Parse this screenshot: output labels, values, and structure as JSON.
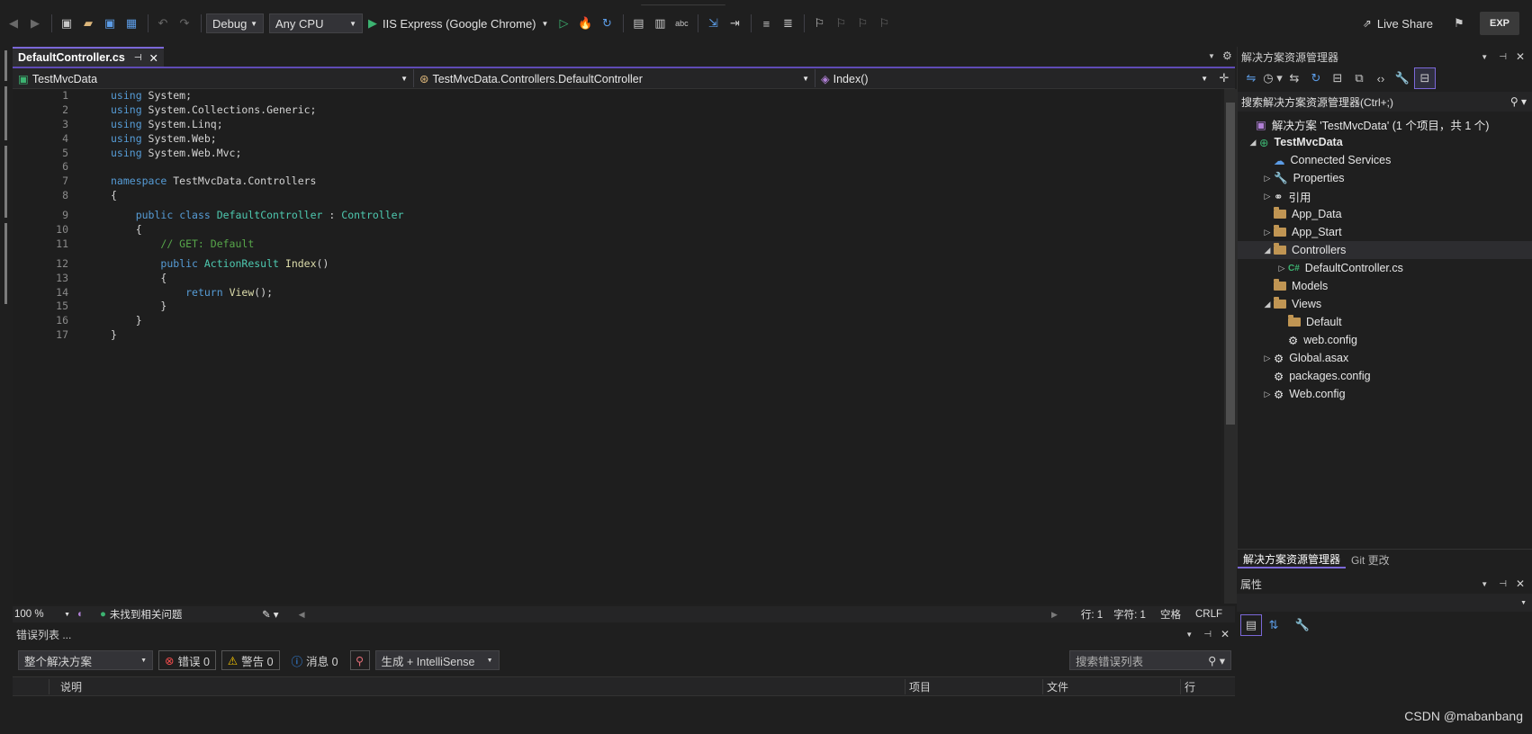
{
  "toolbar": {
    "config": "Debug",
    "platform": "Any CPU",
    "run_target": "IIS Express (Google Chrome)",
    "live_share": "Live Share",
    "exp": "EXP"
  },
  "editor": {
    "tab_title": "DefaultController.cs",
    "nav_project": "TestMvcData",
    "nav_class": "TestMvcData.Controllers.DefaultController",
    "nav_member": "Index()",
    "line_numbers": [
      "1",
      "2",
      "3",
      "4",
      "5",
      "6",
      "7",
      "8",
      "9",
      "10",
      "11",
      "12",
      "13",
      "14",
      "15",
      "16",
      "17"
    ],
    "code": {
      "l1": [
        "using",
        " System;"
      ],
      "l2": [
        "using",
        " System.Collections.Generic;"
      ],
      "l3": [
        "using",
        " System.Linq;"
      ],
      "l4": [
        "using",
        " System.Web;"
      ],
      "l5": [
        "using",
        " System.Web.Mvc;"
      ],
      "l7": [
        "namespace",
        " TestMvcData.Controllers"
      ],
      "l8": "{",
      "l9": [
        "public",
        "class",
        "DefaultController",
        ":",
        "Controller"
      ],
      "l10": "{",
      "l11": "// GET: Default",
      "l12": [
        "public",
        "ActionResult",
        "Index",
        "()"
      ],
      "l13": "{",
      "l14": [
        "return",
        "View",
        "();"
      ],
      "l15": "}",
      "l16": "}",
      "l17": "}"
    },
    "zoom": "100 %",
    "no_issues": "未找到相关问题",
    "line_pos": "行: 1",
    "char_pos": "字符: 1",
    "whitespace": "空格",
    "line_ending": "CRLF"
  },
  "error_list": {
    "title": "错误列表 ...",
    "scope": "整个解决方案",
    "errors": "错误 0",
    "warnings": "警告 0",
    "messages": "消息 0",
    "build_filter": "生成 + IntelliSense",
    "search_placeholder": "搜索错误列表",
    "col_desc": "说明",
    "col_project": "项目",
    "col_file": "文件",
    "col_line": "行"
  },
  "solution_explorer": {
    "title": "解决方案资源管理器",
    "search": "搜索解决方案资源管理器(Ctrl+;)",
    "solution": "解决方案 'TestMvcData' (1 个项目，共 1 个)",
    "project": "TestMvcData",
    "items": {
      "connected": "Connected Services",
      "properties": "Properties",
      "references": "引用",
      "app_data": "App_Data",
      "app_start": "App_Start",
      "controllers": "Controllers",
      "default_controller": "DefaultController.cs",
      "models": "Models",
      "views": "Views",
      "default": "Default",
      "views_webconfig": "web.config",
      "global": "Global.asax",
      "packages": "packages.config",
      "webconfig": "Web.config"
    },
    "tab_solution": "解决方案资源管理器",
    "tab_git": "Git 更改"
  },
  "properties": {
    "title": "属性"
  },
  "watermark": "CSDN @mabanbang"
}
